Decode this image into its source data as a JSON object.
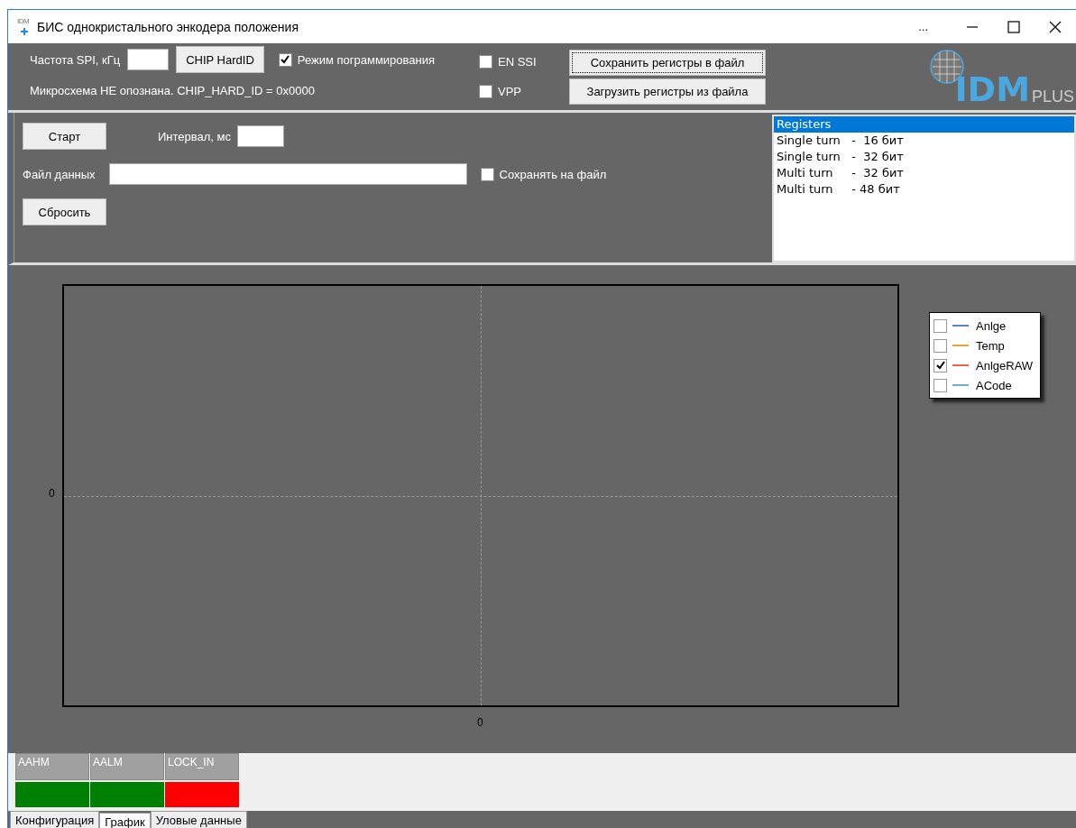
{
  "window": {
    "app_icon_text": "IDM",
    "title": "БИС однокристального энкодера положения",
    "extra_button": "..."
  },
  "toolbar": {
    "spi_label": "Частота SPI, кГц",
    "chip_button": "CHIP HardID",
    "checkboxes": [
      {
        "label": "Режим пограммирования",
        "checked": true
      },
      {
        "label": "EN SSI",
        "checked": false
      },
      {
        "label": "VPP",
        "checked": false
      }
    ],
    "status_text": "Микросхема НЕ опознана. CHIP_HARD_ID = 0x0000",
    "buttons": [
      {
        "label": "Сохранить регистры в файл",
        "focused": true
      },
      {
        "label": "Загрузить регистры из файла",
        "focused": false
      }
    ],
    "logo": {
      "main": "IDM",
      "suffix": "PLUS"
    }
  },
  "controls": {
    "start_button": "Старт",
    "interval_label": "Интервал, мс",
    "data_file_label": "Файл данных",
    "save_to_file": {
      "label": "Сохранять на файл",
      "checked": false
    },
    "reset_button": "Сбросить"
  },
  "registers": {
    "items": [
      {
        "label": "Registers",
        "selected": true
      },
      {
        "label": "Single turn   -  16 бит",
        "selected": false
      },
      {
        "label": "Single turn   -  32 бит",
        "selected": false
      },
      {
        "label": "Multi turn     -  32 бит",
        "selected": false
      },
      {
        "label": "Multi turn     - 48 бит",
        "selected": false
      }
    ]
  },
  "chart": {
    "y_tick": "0",
    "x_tick": "0",
    "legend": [
      {
        "name": "Anlge",
        "color": "#5b7fd1",
        "checked": false
      },
      {
        "name": "Temp",
        "color": "#f0a030",
        "checked": false
      },
      {
        "name": "AnlgeRAW",
        "color": "#f06040",
        "checked": true
      },
      {
        "name": "ACode",
        "color": "#70b0c0",
        "checked": false
      }
    ]
  },
  "indicators": [
    {
      "label": "AAHM",
      "color": "#008000"
    },
    {
      "label": "AALM",
      "color": "#008000"
    },
    {
      "label": "LOCK_IN",
      "color": "#ff0000"
    }
  ],
  "tabs": [
    {
      "label": "Конфигурация",
      "selected": false
    },
    {
      "label": "График",
      "selected": true
    },
    {
      "label": "Уловые данные",
      "selected": false
    }
  ]
}
